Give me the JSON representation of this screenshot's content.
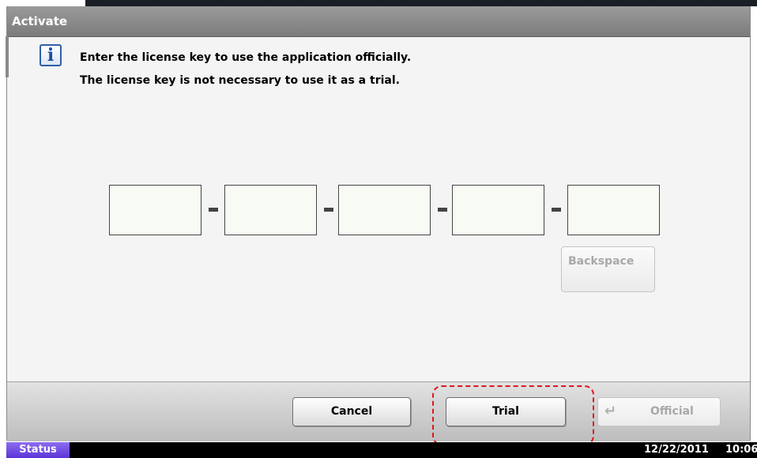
{
  "window": {
    "title": "Activate"
  },
  "message": {
    "line1": "Enter the license key to use the application officially.",
    "line2": "The license key is not necessary to use it as a trial."
  },
  "license_key": {
    "fields": [
      "",
      "",
      "",
      "",
      ""
    ],
    "separator": "-",
    "backspace_label": "Backspace"
  },
  "actions": {
    "cancel_label": "Cancel",
    "trial_label": "Trial",
    "official_label": "Official"
  },
  "status_bar": {
    "status_label": "Status",
    "date": "12/22/2011",
    "time": "10:06"
  },
  "icons": {
    "info": "info-icon",
    "enter": "enter-icon"
  },
  "colors": {
    "highlight": "#e0151d",
    "status_button": "#6a47e0"
  }
}
